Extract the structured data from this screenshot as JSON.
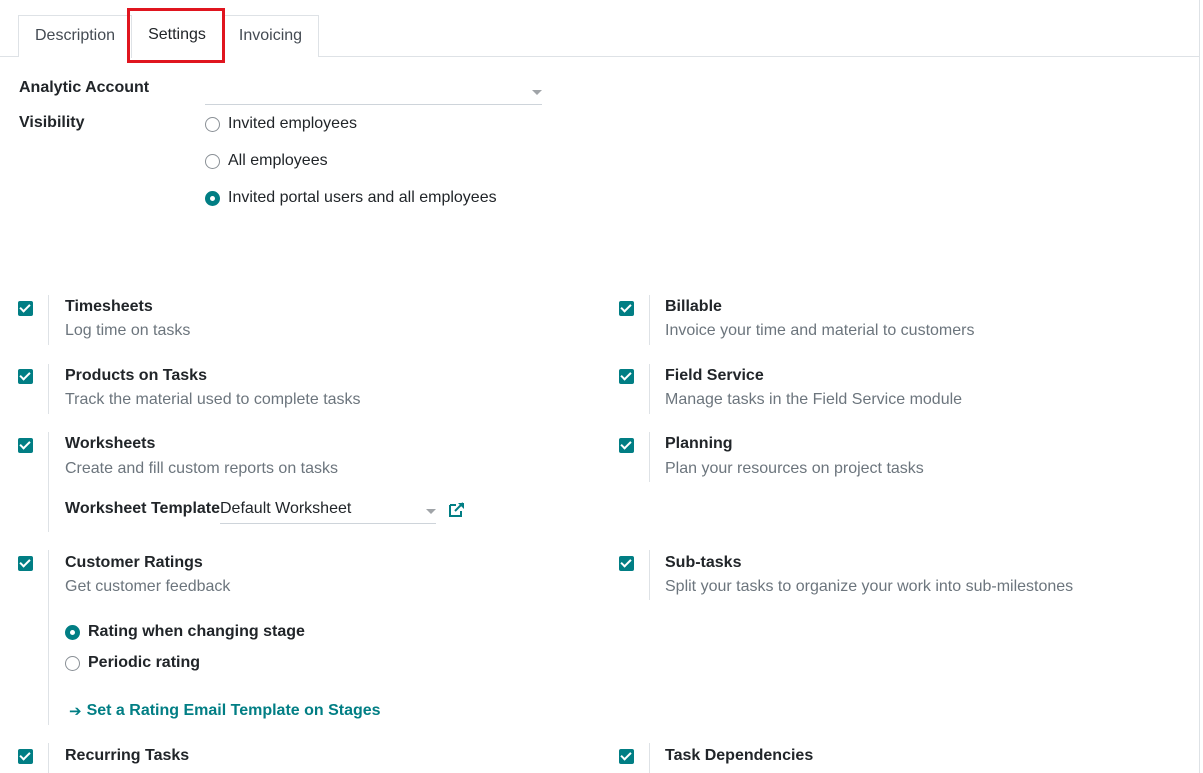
{
  "tabs": [
    {
      "label": "Description",
      "active": false
    },
    {
      "label": "Settings",
      "active": true
    },
    {
      "label": "Invoicing",
      "active": false
    }
  ],
  "form": {
    "analytic_account": {
      "label": "Analytic Account",
      "value": ""
    },
    "visibility": {
      "label": "Visibility",
      "options": [
        {
          "label": "Invited employees",
          "checked": false
        },
        {
          "label": "All employees",
          "checked": false
        },
        {
          "label": "Invited portal users and all employees",
          "checked": true
        }
      ]
    }
  },
  "settings": {
    "timesheets": {
      "title": "Timesheets",
      "desc": "Log time on tasks",
      "checked": true
    },
    "billable": {
      "title": "Billable",
      "desc": "Invoice your time and material to customers",
      "checked": true
    },
    "products_on_tasks": {
      "title": "Products on Tasks",
      "desc": "Track the material used to complete tasks",
      "checked": true
    },
    "field_service": {
      "title": "Field Service",
      "desc": "Manage tasks in the Field Service module",
      "checked": true
    },
    "worksheets": {
      "title": "Worksheets",
      "desc": "Create and fill custom reports on tasks",
      "checked": true,
      "template_label": "Worksheet Template",
      "template_value": "Default Worksheet"
    },
    "planning": {
      "title": "Planning",
      "desc": "Plan your resources on project tasks",
      "checked": true
    },
    "customer_ratings": {
      "title": "Customer Ratings",
      "desc": "Get customer feedback",
      "checked": true,
      "options": [
        {
          "label": "Rating when changing stage",
          "checked": true
        },
        {
          "label": "Periodic rating",
          "checked": false
        }
      ],
      "link": "Set a Rating Email Template on Stages"
    },
    "sub_tasks": {
      "title": "Sub-tasks",
      "desc": "Split your tasks to organize your work into sub-milestones",
      "checked": true
    },
    "recurring_tasks": {
      "title": "Recurring Tasks",
      "checked": true
    },
    "task_dependencies": {
      "title": "Task Dependencies",
      "checked": true
    }
  },
  "colors": {
    "accent": "#017e84",
    "highlight": "#e0151f",
    "muted_text": "#6c757d",
    "border": "#dee2e6"
  },
  "icons": {
    "external_link": "external-link-icon",
    "arrow": "arrow-right-icon"
  }
}
